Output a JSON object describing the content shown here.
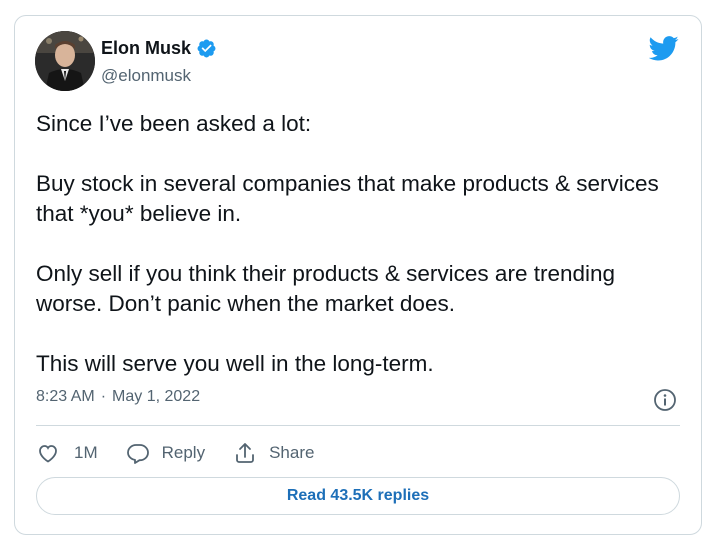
{
  "author": {
    "name": "Elon Musk",
    "handle": "@elonmusk",
    "verified": true
  },
  "tweet": {
    "paragraphs": [
      "Since I’ve been asked a lot:",
      "Buy stock in several companies that make products & services that *you* believe in.",
      "Only sell if you think their products & services are trending worse. Don’t panic when the market does.",
      "This will serve you well in the long-term."
    ],
    "time": "8:23 AM",
    "separator": "·",
    "date": "May 1, 2022"
  },
  "actions": {
    "like_count": "1M",
    "reply_label": "Reply",
    "share_label": "Share"
  },
  "replies_button": "Read 43.5K replies",
  "colors": {
    "brand_blue": "#1d9bf0",
    "link_blue": "#1d6fb8",
    "text": "#0f1419",
    "muted": "#536471",
    "border": "#cfd9de"
  },
  "icons": [
    "verified-badge-icon",
    "twitter-bird-icon",
    "info-icon",
    "heart-icon",
    "reply-bubble-icon",
    "share-icon"
  ]
}
